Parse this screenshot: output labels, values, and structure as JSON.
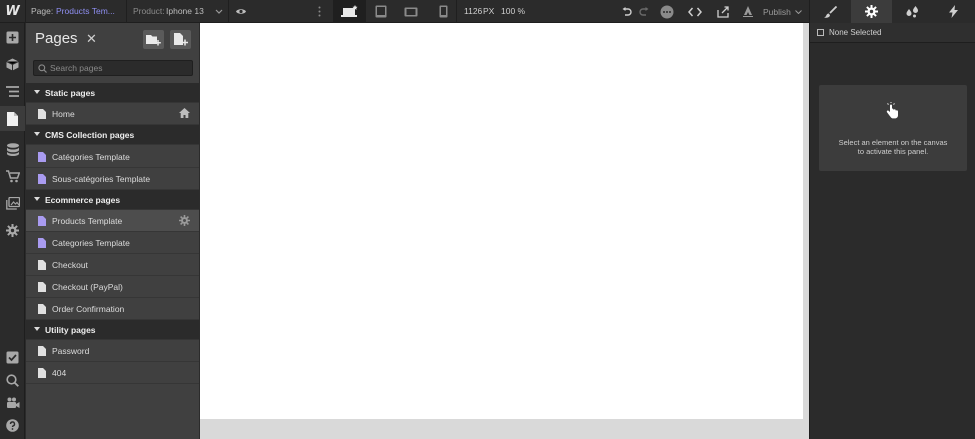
{
  "topbar": {
    "logo": "W",
    "page_prefix": "Page:",
    "page_name": "Products Tem...",
    "product_prefix": "Product:",
    "product_name": "Iphone 13",
    "width_value": "1126",
    "width_unit": "PX",
    "zoom": "100 %",
    "publish_label": "Publish",
    "accent_color": "#8f8ff2"
  },
  "pages_panel": {
    "title": "Pages",
    "search_placeholder": "Search pages",
    "sections": [
      {
        "label": "Static pages",
        "items": [
          {
            "label": "Home",
            "icon": "page-icon",
            "end_icon": "home-icon"
          }
        ]
      },
      {
        "label": "CMS Collection pages",
        "items": [
          {
            "label": "Catégories Template",
            "icon": "cms-page-icon"
          },
          {
            "label": "Sous-catégories Template",
            "icon": "cms-page-icon"
          }
        ]
      },
      {
        "label": "Ecommerce pages",
        "items": [
          {
            "label": "Products Template",
            "icon": "cms-page-icon",
            "end_icon": "gear-icon",
            "selected": true
          },
          {
            "label": "Categories Template",
            "icon": "cms-page-icon"
          },
          {
            "label": "Checkout",
            "icon": "page-icon"
          },
          {
            "label": "Checkout (PayPal)",
            "icon": "page-icon"
          },
          {
            "label": "Order Confirmation",
            "icon": "page-icon"
          }
        ]
      },
      {
        "label": "Utility pages",
        "items": [
          {
            "label": "Password",
            "icon": "page-icon"
          },
          {
            "label": "404",
            "icon": "page-icon"
          }
        ]
      }
    ]
  },
  "right_panel": {
    "selection_label": "None Selected",
    "hint_line1": "Select an element on the canvas",
    "hint_line2": "to activate this panel."
  }
}
